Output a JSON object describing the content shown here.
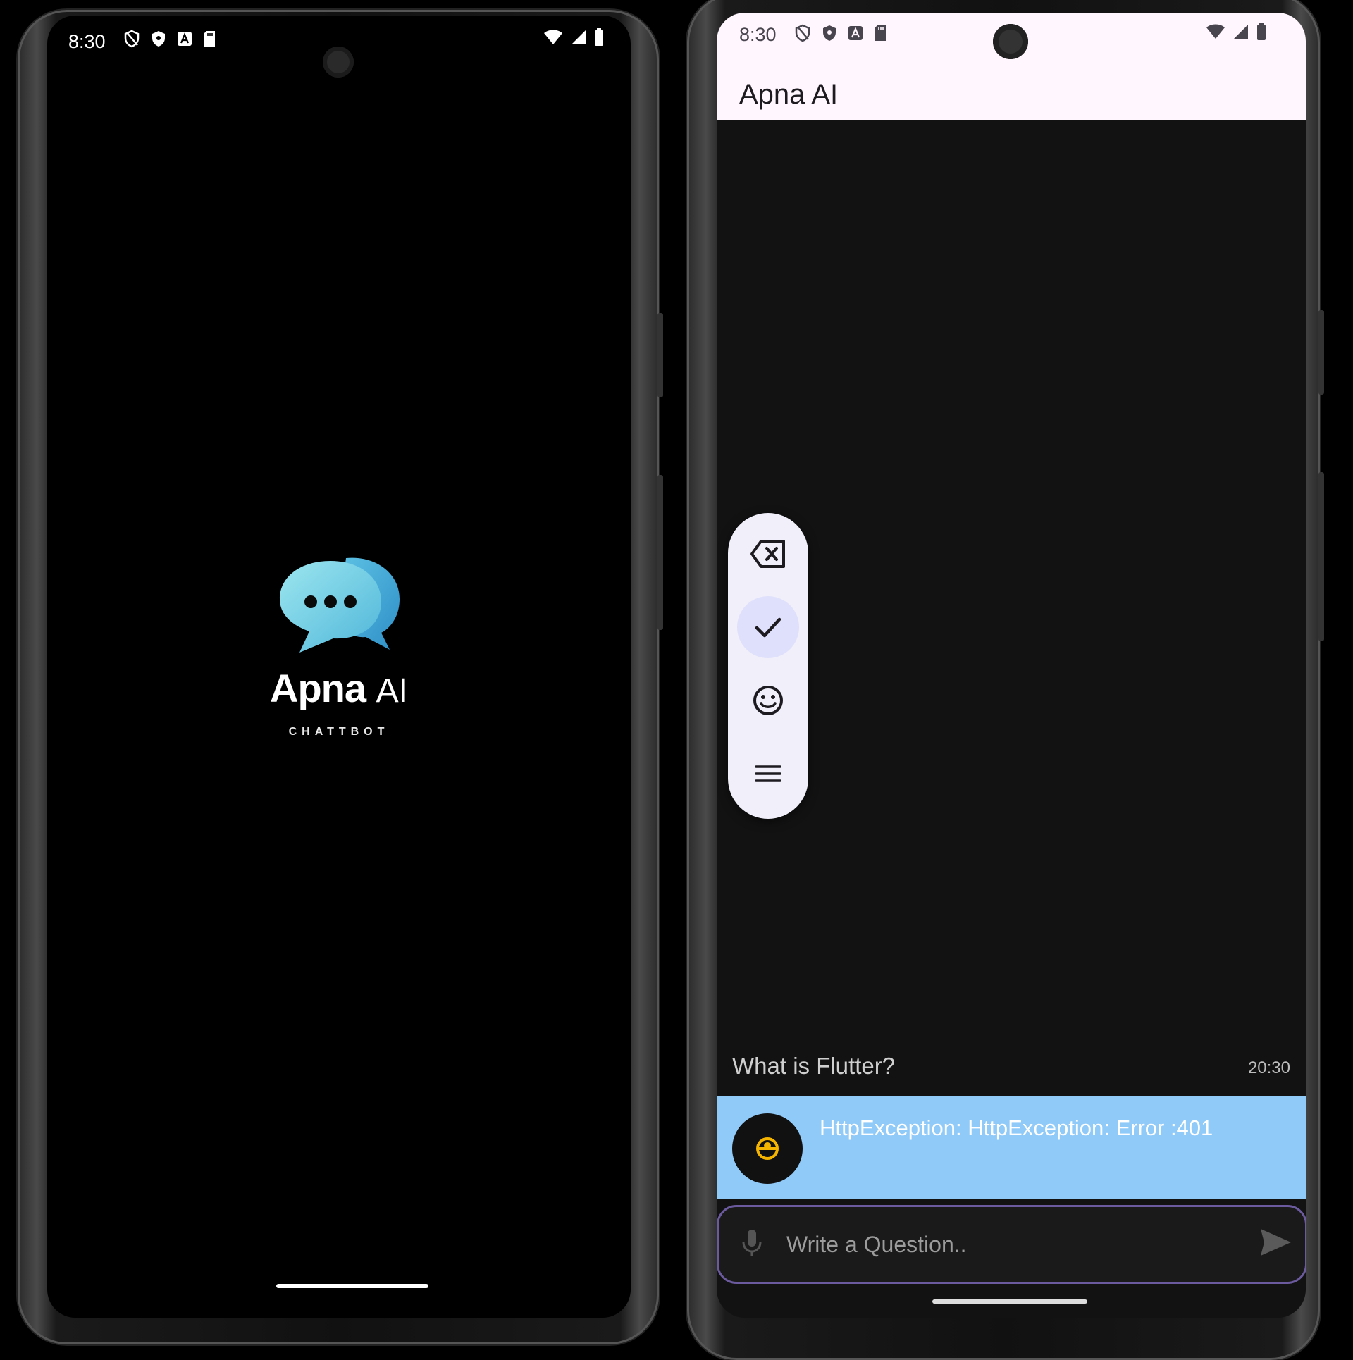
{
  "splash": {
    "status_time": "8:30",
    "logo_word": "Apna",
    "logo_ai": "AI",
    "logo_tagline": "CHATTBOT"
  },
  "chat": {
    "status_time": "8:30",
    "app_title": "Apna AI",
    "user_message": "What is Flutter?",
    "user_time": "20:30",
    "bot_message": "HttpException: HttpException: Error :401",
    "input_placeholder": "Write a Question..",
    "toolbar_icons": [
      "backspace-icon",
      "check-icon",
      "emoji-icon",
      "menu-icon"
    ]
  },
  "colors": {
    "bot_bubble": "#90caf9",
    "appbar": "#fff7fd",
    "input_border": "#6b5a9e",
    "logo_gradient_start": "#7fd6e6",
    "logo_gradient_end": "#4fb3d6"
  }
}
